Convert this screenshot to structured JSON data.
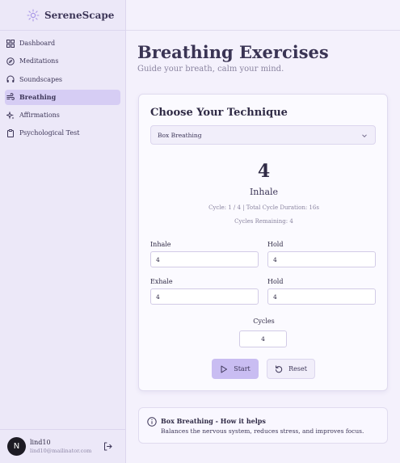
{
  "app": {
    "brand": "SereneScape",
    "brand_icon": "lotus-sun-icon",
    "accent": "#c9bdf2"
  },
  "sidebar": {
    "items": [
      {
        "label": "Dashboard",
        "icon": "grid-icon",
        "active": false
      },
      {
        "label": "Meditations",
        "icon": "compass-icon",
        "active": false
      },
      {
        "label": "Soundscapes",
        "icon": "headphones-icon",
        "active": false
      },
      {
        "label": "Breathing",
        "icon": "wind-icon",
        "active": true
      },
      {
        "label": "Affirmations",
        "icon": "sparkles-icon",
        "active": false
      },
      {
        "label": "Psychological Test",
        "icon": "clipboard-icon",
        "active": false
      }
    ]
  },
  "user": {
    "initial": "N",
    "name": "lind10",
    "email": "lind10@mailinator.com"
  },
  "page": {
    "title": "Breathing Exercises",
    "subtitle": "Guide your breath, calm your mind."
  },
  "technique": {
    "heading": "Choose Your Technique",
    "selected": "Box Breathing",
    "counter": "4",
    "phase": "Inhale",
    "cycle_info": "Cycle: 1 / 4 | Total Cycle Duration: 16s",
    "remaining": "Cycles Remaining: 4",
    "fields": {
      "inhale": {
        "label": "Inhale",
        "value": "4"
      },
      "hold1": {
        "label": "Hold",
        "value": "4"
      },
      "exhale": {
        "label": "Exhale",
        "value": "4"
      },
      "hold2": {
        "label": "Hold",
        "value": "4"
      }
    },
    "cycles": {
      "label": "Cycles",
      "value": "4"
    },
    "start_label": "Start",
    "reset_label": "Reset"
  },
  "info": {
    "title": "Box Breathing - How it helps",
    "description": "Balances the nervous system, reduces stress, and improves focus."
  }
}
